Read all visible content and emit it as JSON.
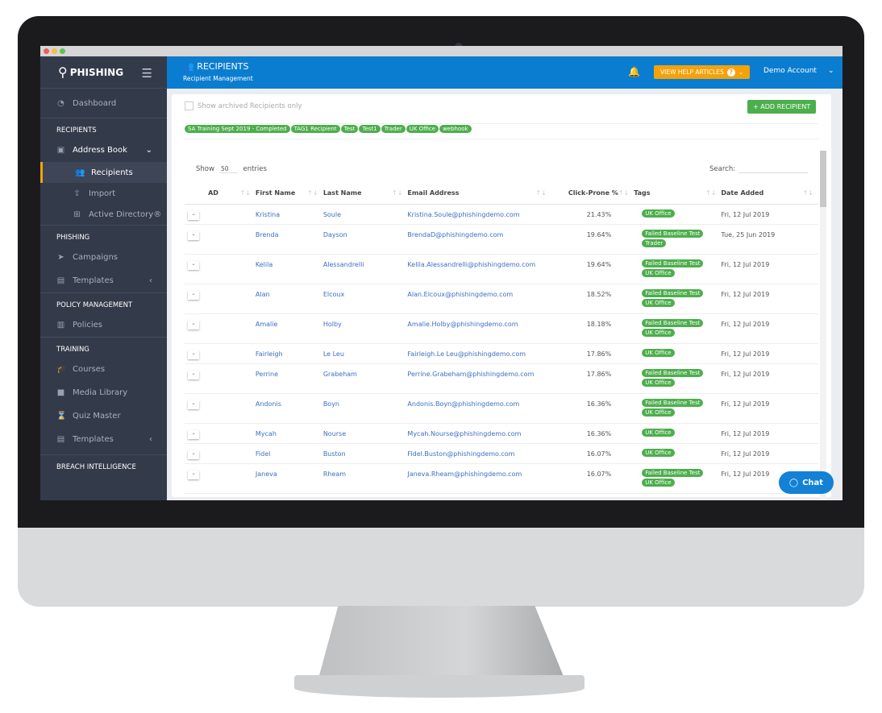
{
  "sidebar": {
    "brand": "PHISHING",
    "items": [
      {
        "label": "Dashboard",
        "icon": "dashboard-icon"
      }
    ],
    "sections": [
      {
        "title": "RECIPIENTS"
      },
      {
        "title": "PHISHING"
      },
      {
        "title": "POLICY MANAGEMENT"
      },
      {
        "title": "TRAINING"
      },
      {
        "title": "BREACH INTELLIGENCE"
      }
    ],
    "address_book": "Address Book",
    "recipients": "Recipients",
    "import": "Import",
    "ad": "Active Directory®",
    "campaigns": "Campaigns",
    "templates": "Templates",
    "policies": "Policies",
    "courses": "Courses",
    "media": "Media Library",
    "quiz": "Quiz Master",
    "templates2": "Templates"
  },
  "header": {
    "title": "RECIPIENTS",
    "subtitle": "Recipient Management",
    "help": "VIEW HELP ARTICLES",
    "account": "Demo Account"
  },
  "toolbar": {
    "archived": "Show archived Recipients only",
    "add": "+ ADD RECIPIENT",
    "filters": [
      "SA Training Sept 2019 - Completed",
      "TAG1 Recipient",
      "Test",
      "Test1",
      "Trader",
      "UK Office",
      "webhook"
    ],
    "show": "Show",
    "entries_value": "50",
    "entries": "entries",
    "search": "Search:"
  },
  "table": {
    "columns": [
      "AD",
      "First Name",
      "Last Name",
      "Email Address",
      "Click-Prone %",
      "Tags",
      "Date Added"
    ],
    "rows": [
      {
        "first": "Kristina",
        "last": "Soule",
        "email": "Kristina.Soule@phishingdemo.com",
        "pct": "21.43%",
        "tags": [
          "UK Office"
        ],
        "date": "Fri, 12 Jul 2019"
      },
      {
        "first": "Brenda",
        "last": "Dayson",
        "email": "BrendaD@phishingdemo.com",
        "pct": "19.64%",
        "tags": [
          "Failed Baseline Test",
          "Trader"
        ],
        "date": "Tue, 25 Jun 2019"
      },
      {
        "first": "Kelila",
        "last": "Alessandrelli",
        "email": "Kelila.Alessandrelli@phishingdemo.com",
        "pct": "19.64%",
        "tags": [
          "Failed Baseline Test",
          "UK Office"
        ],
        "date": "Fri, 12 Jul 2019"
      },
      {
        "first": "Alan",
        "last": "Elcoux",
        "email": "Alan.Elcoux@phishingdemo.com",
        "pct": "18.52%",
        "tags": [
          "Failed Baseline Test",
          "UK Office"
        ],
        "date": "Fri, 12 Jul 2019"
      },
      {
        "first": "Amalie",
        "last": "Holby",
        "email": "Amalie.Holby@phishingdemo.com",
        "pct": "18.18%",
        "tags": [
          "Failed Baseline Test",
          "UK Office"
        ],
        "date": "Fri, 12 Jul 2019"
      },
      {
        "first": "Fairleigh",
        "last": "Le Leu",
        "email": "Fairleigh.Le Leu@phishingdemo.com",
        "pct": "17.86%",
        "tags": [
          "UK Office"
        ],
        "date": "Fri, 12 Jul 2019"
      },
      {
        "first": "Perrine",
        "last": "Grabeham",
        "email": "Perrine.Grabeham@phishingdemo.com",
        "pct": "17.86%",
        "tags": [
          "Failed Baseline Test",
          "UK Office"
        ],
        "date": "Fri, 12 Jul 2019"
      },
      {
        "first": "Andonis",
        "last": "Boyn",
        "email": "Andonis.Boyn@phishingdemo.com",
        "pct": "16.36%",
        "tags": [
          "Failed Baseline Test",
          "UK Office"
        ],
        "date": "Fri, 12 Jul 2019"
      },
      {
        "first": "Mycah",
        "last": "Nourse",
        "email": "Mycah.Nourse@phishingdemo.com",
        "pct": "16.36%",
        "tags": [
          "UK Office"
        ],
        "date": "Fri, 12 Jul 2019"
      },
      {
        "first": "Fidel",
        "last": "Buston",
        "email": "Fidel.Buston@phishingdemo.com",
        "pct": "16.07%",
        "tags": [
          "UK Office"
        ],
        "date": "Fri, 12 Jul 2019"
      },
      {
        "first": "Janeva",
        "last": "Rheam",
        "email": "Janeva.Rheam@phishingdemo.com",
        "pct": "16.07%",
        "tags": [
          "Failed Baseline Test",
          "UK Office"
        ],
        "date": "Fri, 12 Jul 2019"
      }
    ]
  },
  "chat": "Chat",
  "colors": {
    "header": "#0b7dd0",
    "sidebar": "#333a4a",
    "tag": "#4cae4c",
    "help": "#f5a10a"
  }
}
